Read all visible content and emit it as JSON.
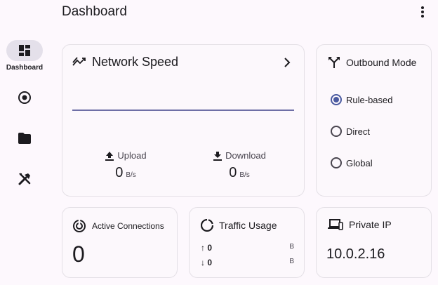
{
  "header": {
    "title": "Dashboard",
    "more_icon": "more-vert-icon"
  },
  "nav": {
    "items": [
      {
        "icon": "dashboard-icon",
        "label": "Dashboard",
        "active": true
      },
      {
        "icon": "radio-button-icon",
        "label": ""
      },
      {
        "icon": "folder-icon",
        "label": ""
      },
      {
        "icon": "tools-icon",
        "label": ""
      }
    ]
  },
  "network_speed": {
    "title": "Network Speed",
    "upload_label": "Upload",
    "upload_value": "0",
    "upload_unit": "B/s",
    "download_label": "Download",
    "download_value": "0",
    "download_unit": "B/s"
  },
  "outbound_mode": {
    "title": "Outbound Mode",
    "options": [
      "Rule-based",
      "Direct",
      "Global"
    ],
    "selected": "Rule-based"
  },
  "active_connections": {
    "title": "Active Connections",
    "value": "0"
  },
  "traffic_usage": {
    "title": "Traffic Usage",
    "up_value": "↑ 0",
    "up_unit": "B",
    "down_value": "↓ 0",
    "down_unit": "B"
  },
  "private_ip": {
    "title": "Private IP",
    "value": "10.0.2.16"
  },
  "colors": {
    "accent": "#4a5aa0",
    "background": "#fdf8fd",
    "nav_active": "#e4e0ea"
  }
}
